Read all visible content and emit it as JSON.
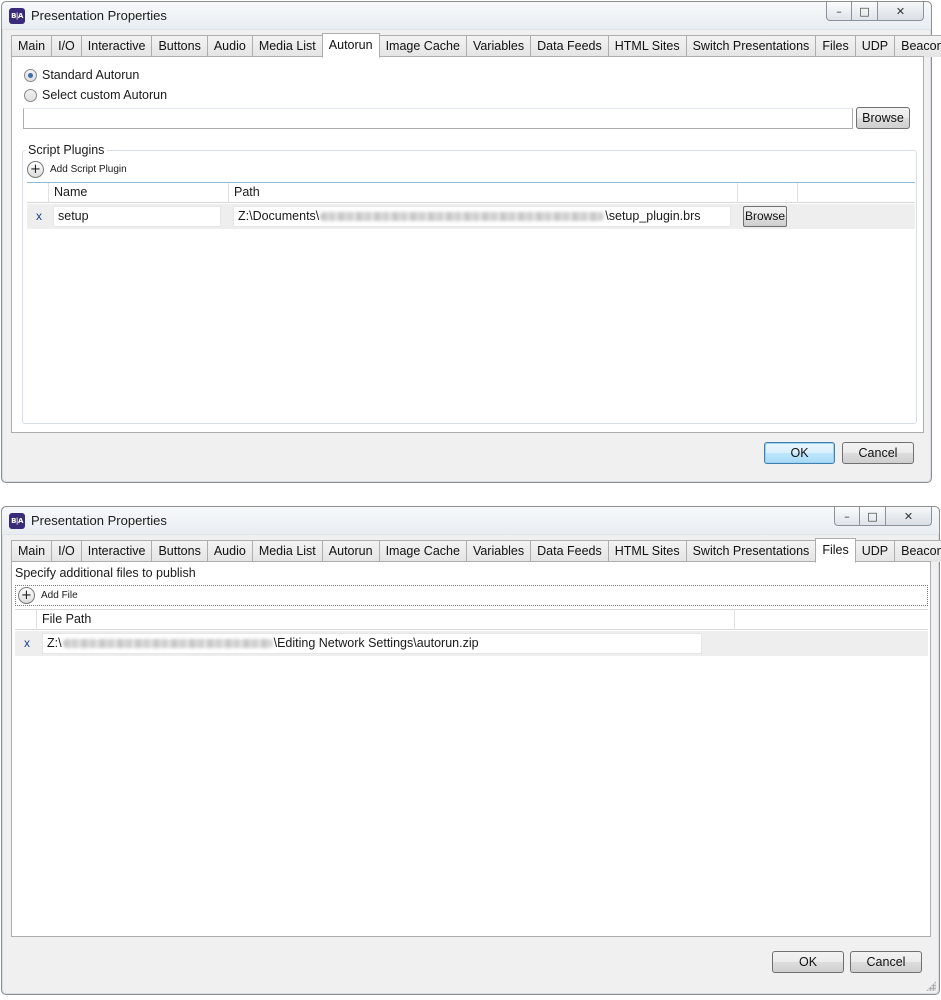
{
  "window1": {
    "title": "Presentation Properties",
    "app_icon_text": "B|A",
    "tabs": [
      "Main",
      "I/O",
      "Interactive",
      "Buttons",
      "Audio",
      "Media List",
      "Autorun",
      "Image Cache",
      "Variables",
      "Data Feeds",
      "HTML Sites",
      "Switch Presentations",
      "Files",
      "UDP",
      "Beacons"
    ],
    "active_tab": "Autorun",
    "autorun": {
      "standard_label": "Standard Autorun",
      "custom_label": "Select custom Autorun",
      "selected": "Standard Autorun",
      "custom_path_value": "",
      "browse_label": "Browse"
    },
    "script_plugins": {
      "group_title": "Script Plugins",
      "add_label": "Add Script Plugin",
      "columns": [
        "Name",
        "Path"
      ],
      "rows": [
        {
          "delete": "x",
          "name": "setup",
          "path_prefix": "Z:\\Documents\\",
          "path_suffix": "\\setup_plugin.brs",
          "browse_label": "Browse"
        }
      ]
    },
    "ok_label": "OK",
    "cancel_label": "Cancel"
  },
  "window2": {
    "title": "Presentation Properties",
    "app_icon_text": "B|A",
    "tabs": [
      "Main",
      "I/O",
      "Interactive",
      "Buttons",
      "Audio",
      "Media List",
      "Autorun",
      "Image Cache",
      "Variables",
      "Data Feeds",
      "HTML Sites",
      "Switch Presentations",
      "Files",
      "UDP",
      "Beacons"
    ],
    "active_tab": "Files",
    "files": {
      "description": "Specify additional files to publish",
      "add_label": "Add File",
      "column": "File Path",
      "rows": [
        {
          "delete": "x",
          "path_prefix": "Z:\\",
          "path_suffix": "\\Editing Network Settings\\autorun.zip"
        }
      ]
    },
    "ok_label": "OK",
    "cancel_label": "Cancel"
  },
  "icons": {
    "minimize": "minimize-icon",
    "maximize": "maximize-icon",
    "close": "close-icon",
    "add": "plus-circle-icon"
  }
}
